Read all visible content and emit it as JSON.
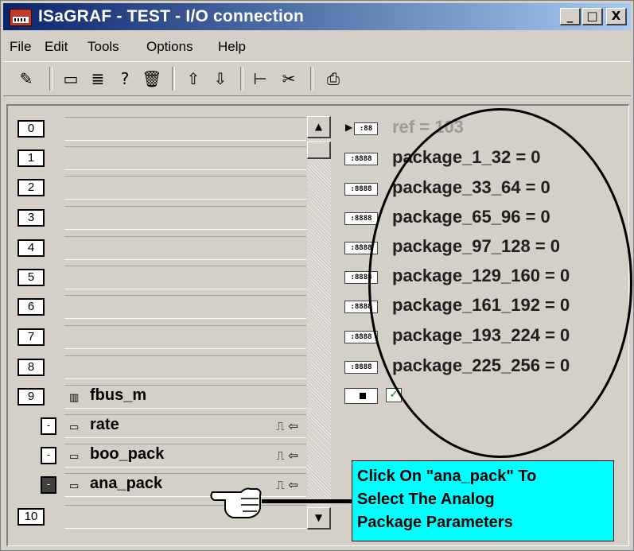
{
  "window": {
    "title": "ISaGRAF - TEST - I/O connection",
    "controls": {
      "minimize": "_",
      "maximize": "□",
      "close": "X"
    }
  },
  "menu": [
    "File",
    "Edit",
    "Tools",
    "Options",
    "Help"
  ],
  "toolbar": [
    {
      "name": "edit-icon",
      "glyph": "✎"
    },
    {
      "name": "board-icon",
      "glyph": "▭"
    },
    {
      "name": "list-icon",
      "glyph": "≣"
    },
    {
      "name": "help-icon",
      "glyph": "?"
    },
    {
      "name": "trash-icon",
      "glyph": "🗑"
    },
    {
      "name": "arrow-up-icon",
      "glyph": "⇧"
    },
    {
      "name": "arrow-down-icon",
      "glyph": "⇩"
    },
    {
      "name": "tree-icon",
      "glyph": "⊢"
    },
    {
      "name": "cut-icon",
      "glyph": "✂"
    },
    {
      "name": "print-icon",
      "glyph": "⎙"
    }
  ],
  "slots": [
    {
      "num": "0",
      "label": ""
    },
    {
      "num": "1",
      "label": ""
    },
    {
      "num": "2",
      "label": ""
    },
    {
      "num": "3",
      "label": ""
    },
    {
      "num": "4",
      "label": ""
    },
    {
      "num": "5",
      "label": ""
    },
    {
      "num": "6",
      "label": ""
    },
    {
      "num": "7",
      "label": ""
    },
    {
      "num": "8",
      "label": ""
    },
    {
      "num": "9",
      "label": "fbus_m"
    }
  ],
  "sub_slots": [
    {
      "box": "-",
      "label": "rate",
      "symbol": "⎍ ⇦"
    },
    {
      "box": "-",
      "label": "boo_pack",
      "symbol": "⎍ ⇦"
    },
    {
      "box": "-",
      "label": "ana_pack",
      "symbol": "⎍ ⇦"
    }
  ],
  "last_slot": {
    "num": "10"
  },
  "params": [
    {
      "icon": ":88",
      "text": "ref = 103"
    },
    {
      "icon": ":8888",
      "text": "package_1_32 = 0"
    },
    {
      "icon": ":8888",
      "text": "package_33_64 = 0"
    },
    {
      "icon": ":8888",
      "text": "package_65_96 = 0"
    },
    {
      "icon": ":8888",
      "text": "package_97_128 = 0"
    },
    {
      "icon": ":8888",
      "text": "package_129_160 = 0"
    },
    {
      "icon": ":8888",
      "text": "package_161_192 = 0"
    },
    {
      "icon": ":8888",
      "text": "package_193_224 = 0"
    },
    {
      "icon": ":8888",
      "text": "package_225_256 = 0"
    }
  ],
  "callout": {
    "lines": [
      "Click On \"ana_pack\" To",
      "Select The Analog",
      "Package Parameters"
    ]
  },
  "colors": {
    "callout_bg": "#00ffff",
    "title_start": "#0a246a",
    "title_end": "#a6caf0"
  }
}
